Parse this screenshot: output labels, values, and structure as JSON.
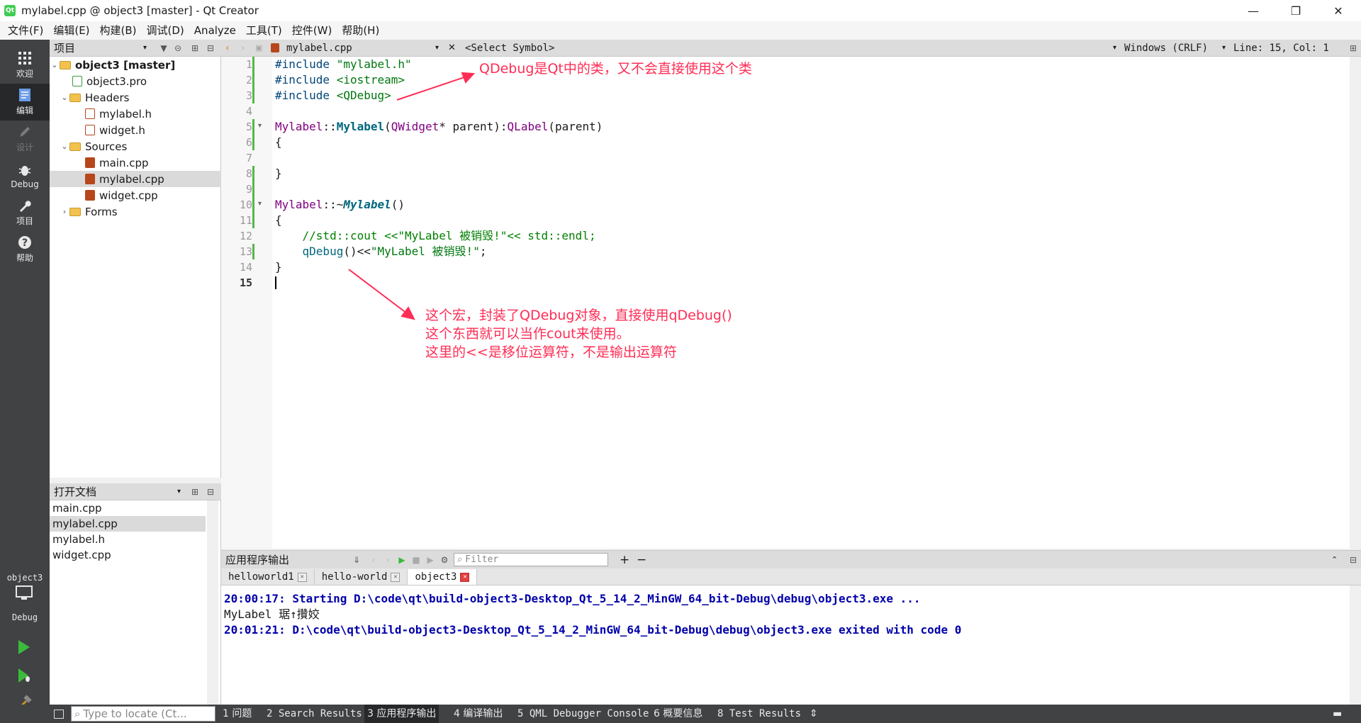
{
  "window": {
    "title": "mylabel.cpp @ object3 [master] - Qt Creator",
    "app_icon": "Qt",
    "minimize": "—",
    "maximize": "❐",
    "close": "✕"
  },
  "menubar": [
    "文件(F)",
    "编辑(E)",
    "构建(B)",
    "调试(D)",
    "Analyze",
    "工具(T)",
    "控件(W)",
    "帮助(H)"
  ],
  "modebar": {
    "items": [
      {
        "label": "欢迎",
        "icon": "grid-icon"
      },
      {
        "label": "编辑",
        "icon": "edit-icon"
      },
      {
        "label": "设计",
        "icon": "pen-icon"
      },
      {
        "label": "Debug",
        "icon": "bug-icon"
      },
      {
        "label": "项目",
        "icon": "wrench-icon"
      },
      {
        "label": "帮助",
        "icon": "help-icon"
      }
    ],
    "target_project": "object3",
    "target_config": "Debug"
  },
  "project_panel": {
    "title": "项目",
    "tree": [
      {
        "label": "object3 [master]",
        "icon": "project-icon"
      },
      {
        "label": "object3.pro",
        "icon": "pro-file-icon"
      },
      {
        "label": "Headers",
        "icon": "folder-icon"
      },
      {
        "label": "mylabel.h",
        "icon": "header-file-icon"
      },
      {
        "label": "widget.h",
        "icon": "header-file-icon"
      },
      {
        "label": "Sources",
        "icon": "folder-icon"
      },
      {
        "label": "main.cpp",
        "icon": "cpp-file-icon"
      },
      {
        "label": "mylabel.cpp",
        "icon": "cpp-file-icon"
      },
      {
        "label": "widget.cpp",
        "icon": "cpp-file-icon"
      },
      {
        "label": "Forms",
        "icon": "folder-icon"
      }
    ]
  },
  "open_docs": {
    "title": "打开文档",
    "items": [
      "main.cpp",
      "mylabel.cpp",
      "mylabel.h",
      "widget.cpp"
    ]
  },
  "editor_toolbar": {
    "file": "mylabel.cpp",
    "symbol": "<Select Symbol>",
    "line_ending": "Windows (CRLF)",
    "position": "Line: 15, Col: 1"
  },
  "editor": {
    "line_numbers": [
      "1",
      "2",
      "3",
      "4",
      "5",
      "6",
      "7",
      "8",
      "9",
      "10",
      "11",
      "12",
      "13",
      "14",
      "15"
    ],
    "lines": [
      [
        {
          "t": "#include ",
          "c": "pp"
        },
        {
          "t": "\"mylabel.h\"",
          "c": "str"
        }
      ],
      [
        {
          "t": "#include ",
          "c": "pp"
        },
        {
          "t": "<iostream>",
          "c": "str"
        }
      ],
      [
        {
          "t": "#include ",
          "c": "pp"
        },
        {
          "t": "<QDebug>",
          "c": "str"
        }
      ],
      [],
      [
        {
          "t": "Mylabel",
          "c": "cls"
        },
        {
          "t": "::",
          "c": "kw"
        },
        {
          "t": "Mylabel",
          "c": "fn"
        },
        {
          "t": "(",
          "c": "kw"
        },
        {
          "t": "QWidget",
          "c": "cls"
        },
        {
          "t": "* parent):",
          "c": "kw"
        },
        {
          "t": "QLabel",
          "c": "cls"
        },
        {
          "t": "(parent)",
          "c": "kw"
        }
      ],
      [
        {
          "t": "{",
          "c": "kw"
        }
      ],
      [],
      [
        {
          "t": "}",
          "c": "kw"
        }
      ],
      [],
      [
        {
          "t": "Mylabel",
          "c": "cls"
        },
        {
          "t": "::~",
          "c": "kw"
        },
        {
          "t": "Mylabel",
          "c": "fn"
        },
        {
          "t": "()",
          "c": "kw"
        }
      ],
      [
        {
          "t": "{",
          "c": "kw"
        }
      ],
      [
        {
          "t": "    //std::cout <<\"MyLabel 被销毁!\"<< std::endl;",
          "c": "com"
        }
      ],
      [
        {
          "t": "    qDebug",
          "c": "pp"
        },
        {
          "t": "()<<",
          "c": "kw"
        },
        {
          "t": "\"MyLabel 被销毁!\"",
          "c": "str"
        },
        {
          "t": ";",
          "c": "kw"
        }
      ],
      [
        {
          "t": "}",
          "c": "kw"
        }
      ],
      []
    ]
  },
  "annotations": {
    "top": "QDebug是Qt中的类，又不会直接使用这个类",
    "bottom_1": "这个宏，封装了QDebug对象，直接使用qDebug()",
    "bottom_2": "这个东西就可以当作cout来使用。",
    "bottom_3": "这里的<<是移位运算符，不是输出运算符"
  },
  "output": {
    "title": "应用程序输出",
    "filter_placeholder": "Filter",
    "tabs": [
      "helloworld1",
      "hello-world",
      "object3"
    ],
    "lines": [
      "20:00:17: Starting D:\\code\\qt\\build-object3-Desktop_Qt_5_14_2_MinGW_64_bit-Debug\\debug\\object3.exe ...",
      "MyLabel 琚↑攢姣",
      "20:01:21: D:\\code\\qt\\build-object3-Desktop_Qt_5_14_2_MinGW_64_bit-Debug\\debug\\object3.exe exited with code 0"
    ]
  },
  "statusbar": {
    "locator_placeholder": "Type to locate (Ct...",
    "items": [
      "1 问题",
      "2 Search Results",
      "3 应用程序输出",
      "4 编译输出",
      "5 QML Debugger Console",
      "6 概要信息",
      "8 Test Results"
    ]
  },
  "colors": {
    "annotation": "#ff2d55",
    "modebar": "#404244",
    "include_green_bar": "#55b848"
  }
}
